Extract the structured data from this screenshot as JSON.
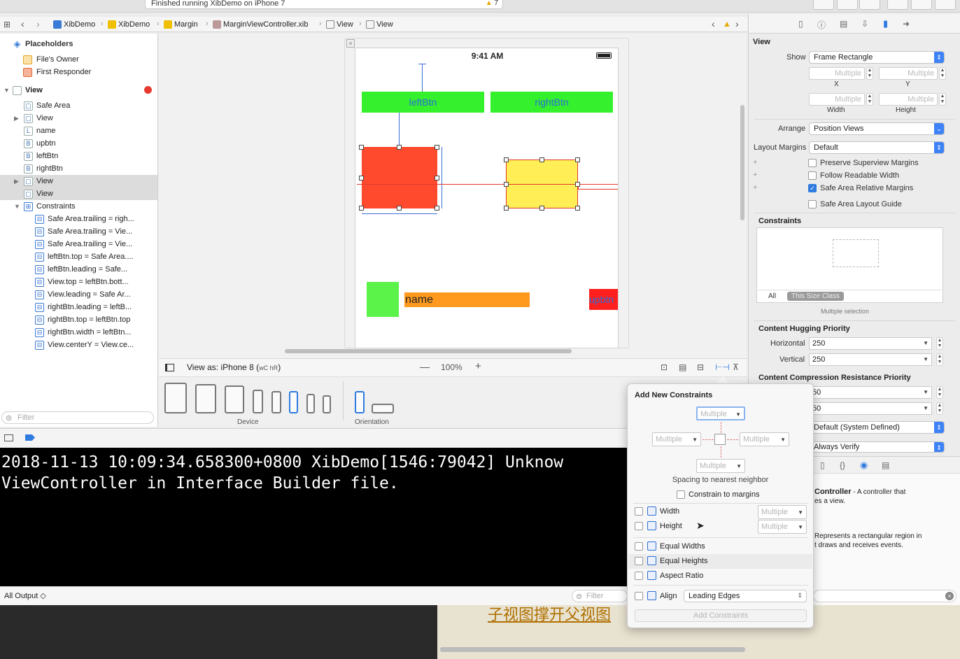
{
  "status": {
    "text": "Finished running XibDemo on iPhone 7",
    "warnings": "7"
  },
  "jumpbar": {
    "crumbs": [
      "XibDemo",
      "XibDemo",
      "Margin",
      "MarginViewController.xib",
      "View",
      "View"
    ]
  },
  "outline": {
    "placeholders": "Placeholders",
    "files_owner": "File's Owner",
    "first_responder": "First Responder",
    "view": "View",
    "children": [
      {
        "icon": "▢",
        "label": "Safe Area"
      },
      {
        "icon": "▢",
        "label": "View"
      },
      {
        "icon": "L",
        "label": "name"
      },
      {
        "icon": "B",
        "label": "upbtn"
      },
      {
        "icon": "B",
        "label": "leftBtn"
      },
      {
        "icon": "B",
        "label": "rightBtn"
      },
      {
        "icon": "▢",
        "label": "View"
      },
      {
        "icon": "▢",
        "label": "View"
      }
    ],
    "constraints_label": "Constraints",
    "constraints": [
      "Safe Area.trailing = righ...",
      "Safe Area.trailing = Vie...",
      "Safe Area.trailing = Vie...",
      "leftBtn.top = Safe Area....",
      "leftBtn.leading = Safe...",
      "View.top = leftBtn.bott...",
      "View.leading = Safe Ar...",
      "rightBtn.leading = leftB...",
      "rightBtn.top = leftBtn.top",
      "rightBtn.width = leftBtn...",
      "View.centerY = View.ce..."
    ],
    "filter_placeholder": "Filter"
  },
  "canvas": {
    "time": "9:41 AM",
    "left_btn": "leftBtn",
    "right_btn": "rightBtn",
    "name_label": "name",
    "upbtn_label": "upbtn",
    "view_as": "View as: iPhone 8 (",
    "size_class": "wC hR",
    "view_as_close": ")",
    "zoom": "100%",
    "device_label": "Device",
    "orientation_label": "Orientation"
  },
  "console": {
    "line1": "2018-11-13 10:09:34.658300+0800 XibDemo[1546:79042] Unknow",
    "line2": "ViewController in Interface Builder file.",
    "output_selector": "All Output ◇",
    "filter_placeholder": "Filter"
  },
  "inspector": {
    "section_title": "View",
    "show_label": "Show",
    "show_value": "Frame Rectangle",
    "multiple": "Multiple",
    "x_label": "X",
    "y_label": "Y",
    "width_label": "Width",
    "height_label": "Height",
    "arrange_label": "Arrange",
    "arrange_value": "Position Views",
    "layout_margins_label": "Layout Margins",
    "layout_margins_value": "Default",
    "preserve": "Preserve Superview Margins",
    "readable": "Follow Readable Width",
    "safe_relative": "Safe Area Relative Margins",
    "safe_guide": "Safe Area Layout Guide",
    "constraints_title": "Constraints",
    "tab_all": "All",
    "tab_size_class": "This Size Class",
    "multiple_selection": "Multiple selection",
    "hugging_title": "Content Hugging Priority",
    "horizontal": "Horizontal",
    "vertical": "Vertical",
    "h_hug": "250",
    "v_hug": "250",
    "compression_title": "Content Compression Resistance Priority",
    "h_comp": "50",
    "v_comp": "50",
    "intrinsic": "Default (System Defined)",
    "ambiguity": "Always Verify",
    "lib_controller_title": "Controller",
    "lib_controller_desc1": " - A controller that",
    "lib_controller_desc2": "es a view.",
    "lib_view_desc1": "Represents a rectangular region in",
    "lib_view_desc2": "t draws and receives events."
  },
  "popover": {
    "title": "Add New Constraints",
    "multiple": "Multiple",
    "spacing_note": "Spacing to nearest neighbor",
    "constrain_margins": "Constrain to margins",
    "width": "Width",
    "height": "Height",
    "equal_widths": "Equal Widths",
    "equal_heights": "Equal Heights",
    "aspect_ratio": "Aspect Ratio",
    "align": "Align",
    "align_value": "Leading Edges",
    "add_button": "Add Constraints"
  },
  "background_text": "子视图撑开父视图",
  "colors": {
    "accent": "#2f7be0",
    "green": "#35f02c",
    "red": "#ff4a2e",
    "yellow": "#ffee55",
    "orange": "#ff9a1f"
  }
}
